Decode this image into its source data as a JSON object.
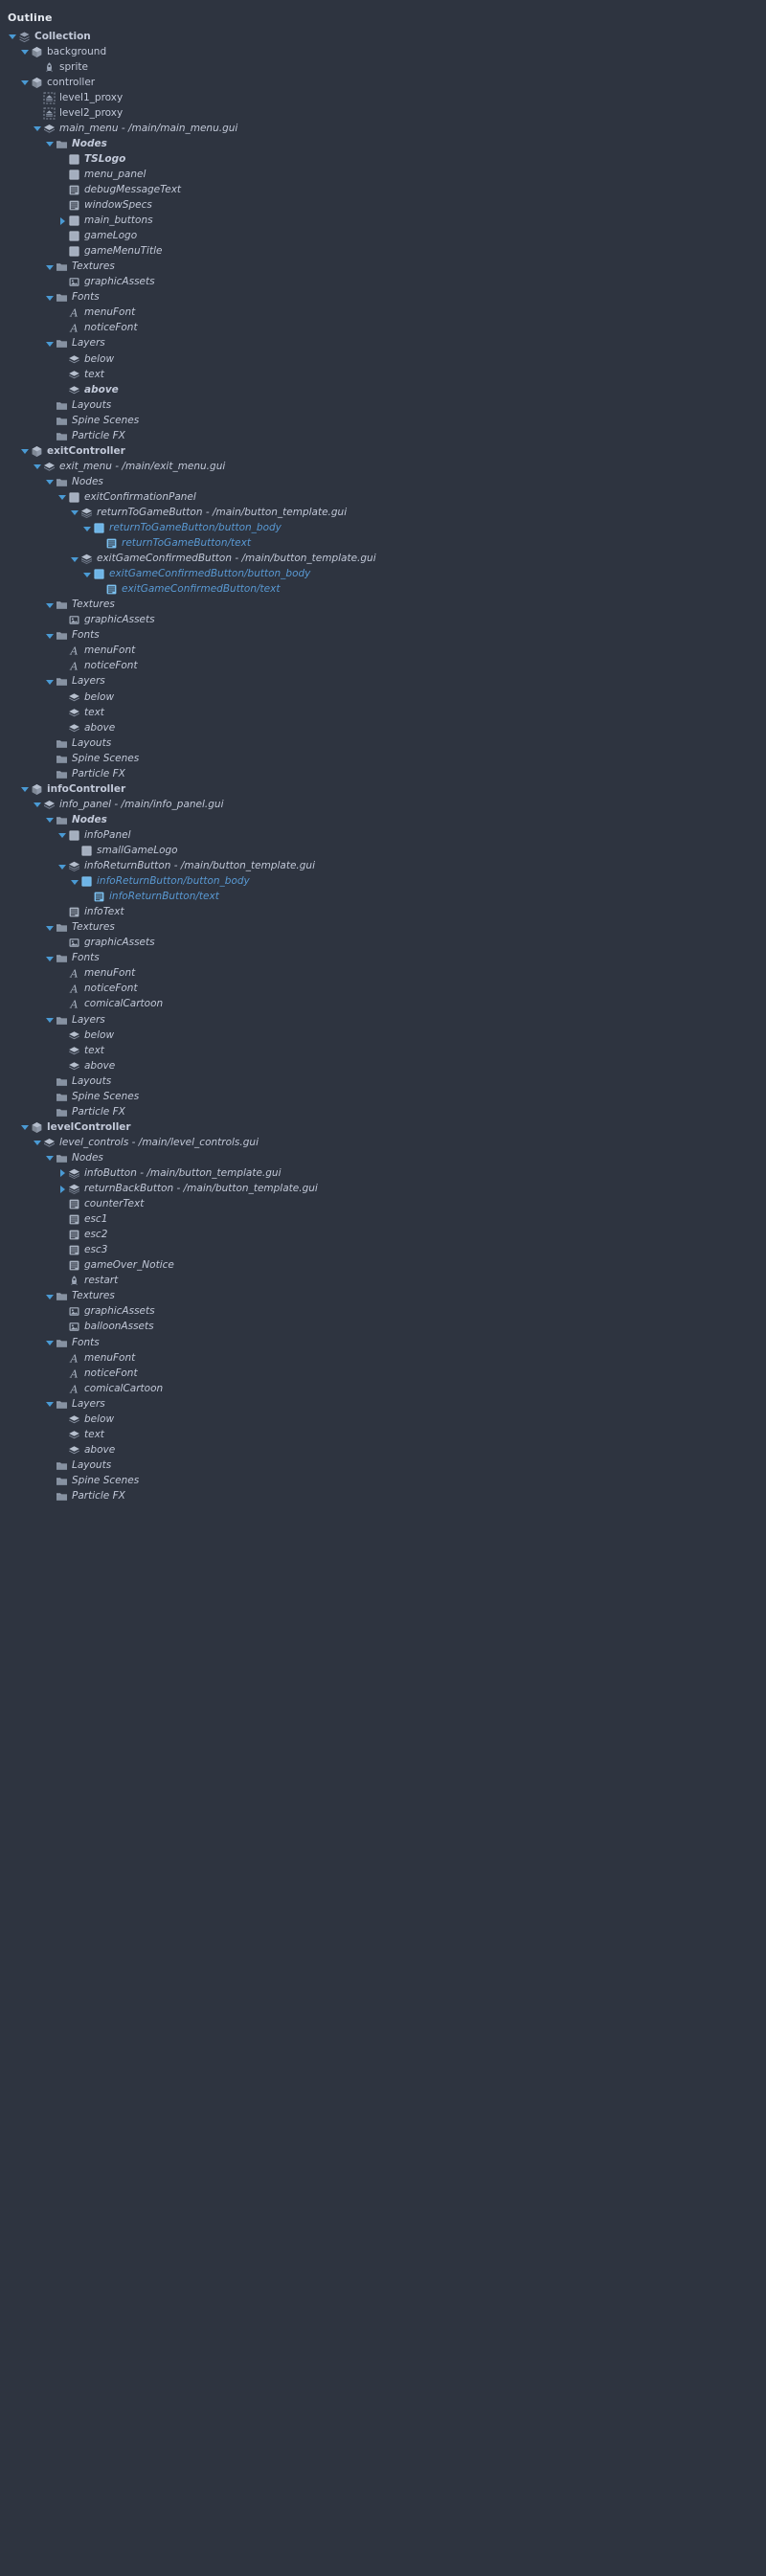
{
  "panel": {
    "title": "Outline",
    "background": "#2e3440",
    "text_color": "#c3cada",
    "template_override_color": "#5b9bd5",
    "twisty_color": "#4a9ad4"
  },
  "icons": {
    "collection": "collection-icon",
    "gameobject": "game-object-icon",
    "sprite": "sprite-icon",
    "proxy": "collection-proxy-icon",
    "gui": "gui-scene-icon",
    "folder": "folder-icon",
    "box": "gui-box-node-icon",
    "text": "gui-text-node-icon",
    "template": "gui-template-node-icon",
    "image": "texture-image-icon",
    "font": "font-icon",
    "layer": "layer-icon",
    "script": "script-icon"
  },
  "tree": [
    {
      "label": "Collection",
      "depth": 0,
      "icon": "collection",
      "twisty": "open",
      "style": "plain bold"
    },
    {
      "label": "background",
      "depth": 1,
      "icon": "gameobject",
      "twisty": "open",
      "style": "plain"
    },
    {
      "label": "sprite",
      "depth": 2,
      "icon": "sprite",
      "twisty": "none",
      "style": "plain"
    },
    {
      "label": "controller",
      "depth": 1,
      "icon": "gameobject",
      "twisty": "open",
      "style": "plain"
    },
    {
      "label": "level1_proxy",
      "depth": 2,
      "icon": "proxy",
      "twisty": "none",
      "style": "plain"
    },
    {
      "label": "level2_proxy",
      "depth": 2,
      "icon": "proxy",
      "twisty": "none",
      "style": "plain"
    },
    {
      "label": "main_menu - /main/main_menu.gui",
      "depth": 2,
      "icon": "gui",
      "twisty": "open",
      "style": "italic"
    },
    {
      "label": "Nodes",
      "depth": 3,
      "icon": "folder",
      "twisty": "open",
      "style": "italic bold"
    },
    {
      "label": "TSLogo",
      "depth": 4,
      "icon": "box",
      "twisty": "none",
      "style": "italic bold"
    },
    {
      "label": "menu_panel",
      "depth": 4,
      "icon": "box",
      "twisty": "none",
      "style": "italic"
    },
    {
      "label": "debugMessageText",
      "depth": 4,
      "icon": "text",
      "twisty": "none",
      "style": "italic"
    },
    {
      "label": "windowSpecs",
      "depth": 4,
      "icon": "text",
      "twisty": "none",
      "style": "italic"
    },
    {
      "label": "main_buttons",
      "depth": 4,
      "icon": "box",
      "twisty": "closed",
      "style": "italic"
    },
    {
      "label": "gameLogo",
      "depth": 4,
      "icon": "box",
      "twisty": "none",
      "style": "italic"
    },
    {
      "label": "gameMenuTitle",
      "depth": 4,
      "icon": "box",
      "twisty": "none",
      "style": "italic"
    },
    {
      "label": "Textures",
      "depth": 3,
      "icon": "folder",
      "twisty": "open",
      "style": "italic"
    },
    {
      "label": "graphicAssets",
      "depth": 4,
      "icon": "image",
      "twisty": "none",
      "style": "italic"
    },
    {
      "label": "Fonts",
      "depth": 3,
      "icon": "folder",
      "twisty": "open",
      "style": "italic"
    },
    {
      "label": "menuFont",
      "depth": 4,
      "icon": "font",
      "twisty": "none",
      "style": "italic"
    },
    {
      "label": "noticeFont",
      "depth": 4,
      "icon": "font",
      "twisty": "none",
      "style": "italic"
    },
    {
      "label": "Layers",
      "depth": 3,
      "icon": "folder",
      "twisty": "open",
      "style": "italic"
    },
    {
      "label": "below",
      "depth": 4,
      "icon": "layer",
      "twisty": "none",
      "style": "italic"
    },
    {
      "label": "text",
      "depth": 4,
      "icon": "layer",
      "twisty": "none",
      "style": "italic"
    },
    {
      "label": "above",
      "depth": 4,
      "icon": "layer",
      "twisty": "none",
      "style": "italic bold"
    },
    {
      "label": "Layouts",
      "depth": 3,
      "icon": "folder",
      "twisty": "none",
      "style": "italic"
    },
    {
      "label": "Spine Scenes",
      "depth": 3,
      "icon": "folder",
      "twisty": "none",
      "style": "italic"
    },
    {
      "label": "Particle FX",
      "depth": 3,
      "icon": "folder",
      "twisty": "none",
      "style": "italic"
    },
    {
      "label": "exitController",
      "depth": 1,
      "icon": "gameobject",
      "twisty": "open",
      "style": "plain bold"
    },
    {
      "label": "exit_menu - /main/exit_menu.gui",
      "depth": 2,
      "icon": "gui",
      "twisty": "open",
      "style": "italic"
    },
    {
      "label": "Nodes",
      "depth": 3,
      "icon": "folder",
      "twisty": "open",
      "style": "italic"
    },
    {
      "label": "exitConfirmationPanel",
      "depth": 4,
      "icon": "box",
      "twisty": "open",
      "style": "italic"
    },
    {
      "label": "returnToGameButton - /main/button_template.gui",
      "depth": 5,
      "icon": "template",
      "twisty": "open",
      "style": "italic"
    },
    {
      "label": "returnToGameButton/button_body",
      "depth": 6,
      "icon": "box",
      "twisty": "open",
      "style": "italic tmpl"
    },
    {
      "label": "returnToGameButton/text",
      "depth": 7,
      "icon": "text",
      "twisty": "none",
      "style": "italic tmpl"
    },
    {
      "label": "exitGameConfirmedButton - /main/button_template.gui",
      "depth": 5,
      "icon": "template",
      "twisty": "open",
      "style": "italic"
    },
    {
      "label": "exitGameConfirmedButton/button_body",
      "depth": 6,
      "icon": "box",
      "twisty": "open",
      "style": "italic tmpl"
    },
    {
      "label": "exitGameConfirmedButton/text",
      "depth": 7,
      "icon": "text",
      "twisty": "none",
      "style": "italic tmpl"
    },
    {
      "label": "Textures",
      "depth": 3,
      "icon": "folder",
      "twisty": "open",
      "style": "italic"
    },
    {
      "label": "graphicAssets",
      "depth": 4,
      "icon": "image",
      "twisty": "none",
      "style": "italic"
    },
    {
      "label": "Fonts",
      "depth": 3,
      "icon": "folder",
      "twisty": "open",
      "style": "italic"
    },
    {
      "label": "menuFont",
      "depth": 4,
      "icon": "font",
      "twisty": "none",
      "style": "italic"
    },
    {
      "label": "noticeFont",
      "depth": 4,
      "icon": "font",
      "twisty": "none",
      "style": "italic"
    },
    {
      "label": "Layers",
      "depth": 3,
      "icon": "folder",
      "twisty": "open",
      "style": "italic"
    },
    {
      "label": "below",
      "depth": 4,
      "icon": "layer",
      "twisty": "none",
      "style": "italic"
    },
    {
      "label": "text",
      "depth": 4,
      "icon": "layer",
      "twisty": "none",
      "style": "italic"
    },
    {
      "label": "above",
      "depth": 4,
      "icon": "layer",
      "twisty": "none",
      "style": "italic"
    },
    {
      "label": "Layouts",
      "depth": 3,
      "icon": "folder",
      "twisty": "none",
      "style": "italic"
    },
    {
      "label": "Spine Scenes",
      "depth": 3,
      "icon": "folder",
      "twisty": "none",
      "style": "italic"
    },
    {
      "label": "Particle FX",
      "depth": 3,
      "icon": "folder",
      "twisty": "none",
      "style": "italic"
    },
    {
      "label": "infoController",
      "depth": 1,
      "icon": "gameobject",
      "twisty": "open",
      "style": "plain bold"
    },
    {
      "label": "info_panel - /main/info_panel.gui",
      "depth": 2,
      "icon": "gui",
      "twisty": "open",
      "style": "italic"
    },
    {
      "label": "Nodes",
      "depth": 3,
      "icon": "folder",
      "twisty": "open",
      "style": "italic bold"
    },
    {
      "label": "infoPanel",
      "depth": 4,
      "icon": "box",
      "twisty": "open",
      "style": "italic"
    },
    {
      "label": "smallGameLogo",
      "depth": 5,
      "icon": "box",
      "twisty": "none",
      "style": "italic"
    },
    {
      "label": "infoReturnButton - /main/button_template.gui",
      "depth": 4,
      "icon": "template",
      "twisty": "open",
      "style": "italic"
    },
    {
      "label": "infoReturnButton/button_body",
      "depth": 5,
      "icon": "box",
      "twisty": "open",
      "style": "italic tmpl"
    },
    {
      "label": "infoReturnButton/text",
      "depth": 6,
      "icon": "text",
      "twisty": "none",
      "style": "italic tmpl"
    },
    {
      "label": "infoText",
      "depth": 4,
      "icon": "text",
      "twisty": "none",
      "style": "italic"
    },
    {
      "label": "Textures",
      "depth": 3,
      "icon": "folder",
      "twisty": "open",
      "style": "italic"
    },
    {
      "label": "graphicAssets",
      "depth": 4,
      "icon": "image",
      "twisty": "none",
      "style": "italic"
    },
    {
      "label": "Fonts",
      "depth": 3,
      "icon": "folder",
      "twisty": "open",
      "style": "italic"
    },
    {
      "label": "menuFont",
      "depth": 4,
      "icon": "font",
      "twisty": "none",
      "style": "italic"
    },
    {
      "label": "noticeFont",
      "depth": 4,
      "icon": "font",
      "twisty": "none",
      "style": "italic"
    },
    {
      "label": "comicalCartoon",
      "depth": 4,
      "icon": "font",
      "twisty": "none",
      "style": "italic"
    },
    {
      "label": "Layers",
      "depth": 3,
      "icon": "folder",
      "twisty": "open",
      "style": "italic"
    },
    {
      "label": "below",
      "depth": 4,
      "icon": "layer",
      "twisty": "none",
      "style": "italic"
    },
    {
      "label": "text",
      "depth": 4,
      "icon": "layer",
      "twisty": "none",
      "style": "italic"
    },
    {
      "label": "above",
      "depth": 4,
      "icon": "layer",
      "twisty": "none",
      "style": "italic"
    },
    {
      "label": "Layouts",
      "depth": 3,
      "icon": "folder",
      "twisty": "none",
      "style": "italic"
    },
    {
      "label": "Spine Scenes",
      "depth": 3,
      "icon": "folder",
      "twisty": "none",
      "style": "italic"
    },
    {
      "label": "Particle FX",
      "depth": 3,
      "icon": "folder",
      "twisty": "none",
      "style": "italic"
    },
    {
      "label": "levelController",
      "depth": 1,
      "icon": "gameobject",
      "twisty": "open",
      "style": "plain bold"
    },
    {
      "label": "level_controls - /main/level_controls.gui",
      "depth": 2,
      "icon": "gui",
      "twisty": "open",
      "style": "italic"
    },
    {
      "label": "Nodes",
      "depth": 3,
      "icon": "folder",
      "twisty": "open",
      "style": "italic"
    },
    {
      "label": "infoButton - /main/button_template.gui",
      "depth": 4,
      "icon": "template",
      "twisty": "closed",
      "style": "italic"
    },
    {
      "label": "returnBackButton - /main/button_template.gui",
      "depth": 4,
      "icon": "template",
      "twisty": "closed",
      "style": "italic"
    },
    {
      "label": "counterText",
      "depth": 4,
      "icon": "text",
      "twisty": "none",
      "style": "italic"
    },
    {
      "label": "esc1",
      "depth": 4,
      "icon": "text",
      "twisty": "none",
      "style": "italic"
    },
    {
      "label": "esc2",
      "depth": 4,
      "icon": "text",
      "twisty": "none",
      "style": "italic"
    },
    {
      "label": "esc3",
      "depth": 4,
      "icon": "text",
      "twisty": "none",
      "style": "italic"
    },
    {
      "label": "gameOver_Notice",
      "depth": 4,
      "icon": "text",
      "twisty": "none",
      "style": "italic"
    },
    {
      "label": "restart",
      "depth": 4,
      "icon": "sprite",
      "twisty": "none",
      "style": "italic"
    },
    {
      "label": "Textures",
      "depth": 3,
      "icon": "folder",
      "twisty": "open",
      "style": "italic"
    },
    {
      "label": "graphicAssets",
      "depth": 4,
      "icon": "image",
      "twisty": "none",
      "style": "italic"
    },
    {
      "label": "balloonAssets",
      "depth": 4,
      "icon": "image",
      "twisty": "none",
      "style": "italic"
    },
    {
      "label": "Fonts",
      "depth": 3,
      "icon": "folder",
      "twisty": "open",
      "style": "italic"
    },
    {
      "label": "menuFont",
      "depth": 4,
      "icon": "font",
      "twisty": "none",
      "style": "italic"
    },
    {
      "label": "noticeFont",
      "depth": 4,
      "icon": "font",
      "twisty": "none",
      "style": "italic"
    },
    {
      "label": "comicalCartoon",
      "depth": 4,
      "icon": "font",
      "twisty": "none",
      "style": "italic"
    },
    {
      "label": "Layers",
      "depth": 3,
      "icon": "folder",
      "twisty": "open",
      "style": "italic"
    },
    {
      "label": "below",
      "depth": 4,
      "icon": "layer",
      "twisty": "none",
      "style": "italic"
    },
    {
      "label": "text",
      "depth": 4,
      "icon": "layer",
      "twisty": "none",
      "style": "italic"
    },
    {
      "label": "above",
      "depth": 4,
      "icon": "layer",
      "twisty": "none",
      "style": "italic"
    },
    {
      "label": "Layouts",
      "depth": 3,
      "icon": "folder",
      "twisty": "none",
      "style": "italic"
    },
    {
      "label": "Spine Scenes",
      "depth": 3,
      "icon": "folder",
      "twisty": "none",
      "style": "italic"
    },
    {
      "label": "Particle FX",
      "depth": 3,
      "icon": "folder",
      "twisty": "none",
      "style": "italic"
    }
  ]
}
